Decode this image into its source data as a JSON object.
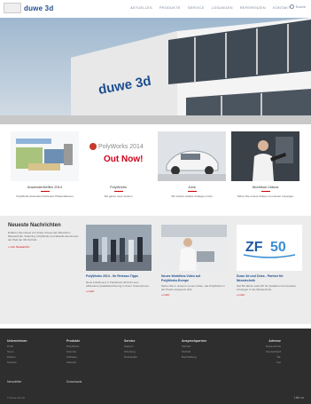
{
  "header": {
    "logo_text": "duwe 3d",
    "nav": [
      "Aktuelles",
      "Produkte",
      "Service",
      "Lösungen",
      "Referenzen",
      "Kontakt"
    ],
    "search_label": "Suche"
  },
  "hero": {
    "building_sign": "duwe 3d"
  },
  "tiles": [
    {
      "title": "Anwendertreffen 2014",
      "desc": "PolyWorks Anwender-Konferenz Präsentationen"
    },
    {
      "title": "PolyWorks",
      "desc": "Die ganze neue Version",
      "image_text": "PolyWorks 2014",
      "badge": "Out Now!"
    },
    {
      "title": "Jobs",
      "desc": "Wir suchen weitere Kollegen (m/w)"
    },
    {
      "title": "Workflow-Videos",
      "desc": "Sehen Sie unsere Videos zu unseren Lösungen"
    }
  ],
  "news": {
    "heading": "Neueste Nachrichten",
    "text": "Erfahren Sie Neues von Duwe 3d aus den Bereichen Messtechnik, Scanning, PolyWorks und aktuelle Events aus der Welt der 3D-Technik.",
    "link": "» zum Newsarchiv",
    "cards": [
      {
        "title": "PolyWorks 2014 - Ihr Release-Tipps",
        "desc": "Neue Funktionen in PolyWorks 2014 für eine effizientere Qualitätssicherung in Ihrem Unternehmen.",
        "more": "» mehr"
      },
      {
        "title": "Neues Workflow-Video auf PolyWorks.Europe",
        "desc": "Sehen Sie in unserem neuen Video, wie PolyWorks in der Praxis eingesetzt wird.",
        "more": "» mehr"
      },
      {
        "title": "Duwe 3d und Zeiss - Partner für Messtechnik",
        "desc": "Seit 50 Jahren steht ZF für Qualität und innovative Lösungen in der Messtechnik.",
        "more": "» mehr",
        "logo_text": "ZF",
        "logo_number": "50"
      }
    ]
  },
  "footer": {
    "columns": [
      {
        "head": "Unternehmen",
        "items": [
          "Profil",
          "Team",
          "Partner",
          "Karriere"
        ]
      },
      {
        "head": "Produkte",
        "items": [
          "PolyWorks",
          "Scanner",
          "Software",
          "Zubehör"
        ]
      },
      {
        "head": "Service",
        "items": [
          "Support",
          "Schulung",
          "Downloads"
        ]
      },
      {
        "head": "Ansprechpartner",
        "items": [
          "Vertrieb",
          "Technik",
          "Buchhaltung"
        ]
      },
      {
        "head": "Adresse",
        "items": [
          "Duwe-3d AG",
          "Deutschland",
          "Tel.",
          "Fax"
        ]
      }
    ],
    "bottom_left": "Newsletter",
    "bottom_mid": "Downloads",
    "copyright": "© Duwe-3d AG",
    "social": "Like us"
  }
}
